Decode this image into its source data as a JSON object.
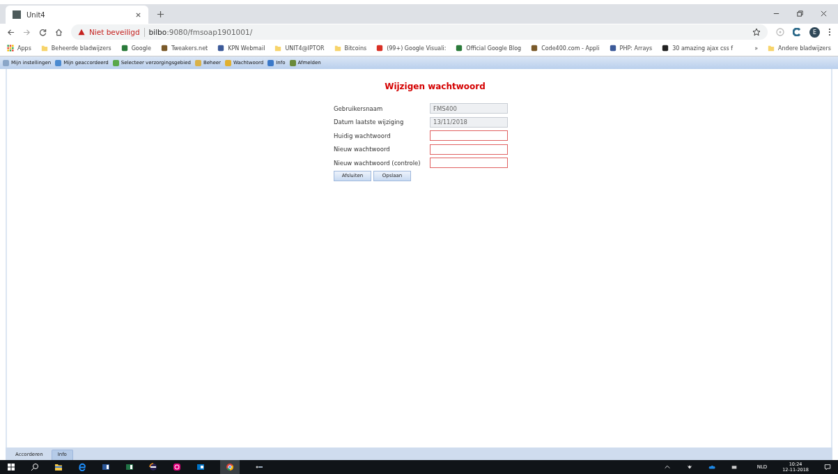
{
  "browser": {
    "tab_title": "Unit4",
    "warning": "Niet beveiligd",
    "url_host": "bilbo",
    "url_rest": ":9080/fmsoap1901001/"
  },
  "bookmarks": [
    {
      "label": "Apps",
      "kind": "apps"
    },
    {
      "label": "Beheerde bladwijzers",
      "kind": "folder"
    },
    {
      "label": "Google",
      "kind": "site"
    },
    {
      "label": "Tweakers.net",
      "kind": "site"
    },
    {
      "label": "KPN Webmail",
      "kind": "site"
    },
    {
      "label": "UNIT4@IPTOR",
      "kind": "folder"
    },
    {
      "label": "Bitcoins",
      "kind": "folder"
    },
    {
      "label": "(99+) Google Visuali:",
      "kind": "site"
    },
    {
      "label": "Official Google Blog",
      "kind": "site"
    },
    {
      "label": "Code400.com - Appli",
      "kind": "site"
    },
    {
      "label": "PHP: Arrays",
      "kind": "site"
    },
    {
      "label": "30 amazing ajax css f",
      "kind": "site"
    }
  ],
  "bookmarks_overflow": "»",
  "other_bookmarks": "Andere bladwijzers",
  "profile_initial": "E",
  "menu": [
    "Mijn instellingen",
    "Mijn geaccordeerd",
    "Selecteer verzorgingsgebied",
    "Beheer",
    "Wachtwoord",
    "Info",
    "Afmelden"
  ],
  "form": {
    "title": "Wijzigen wachtwoord",
    "fields": [
      {
        "label": "Gebruikersnaam",
        "value": "FMS400",
        "readonly": true,
        "invalid": false
      },
      {
        "label": "Datum laatste wijziging",
        "value": "13/11/2018",
        "readonly": true,
        "invalid": false
      },
      {
        "label": "Huidig wachtwoord",
        "readonly": false,
        "invalid": true
      },
      {
        "label": "Nieuw wachtwoord",
        "readonly": false,
        "invalid": true
      },
      {
        "label": "Nieuw wachtwoord (controle)",
        "readonly": false,
        "invalid": true
      }
    ],
    "buttons": [
      "Afsluiten",
      "Opslaan"
    ]
  },
  "bottom_tabs": [
    {
      "label": "Accorderen",
      "selected": false
    },
    {
      "label": "Info",
      "selected": true
    }
  ],
  "tray": {
    "language": "NLD",
    "time": "10:24",
    "date": "12-11-2018"
  }
}
